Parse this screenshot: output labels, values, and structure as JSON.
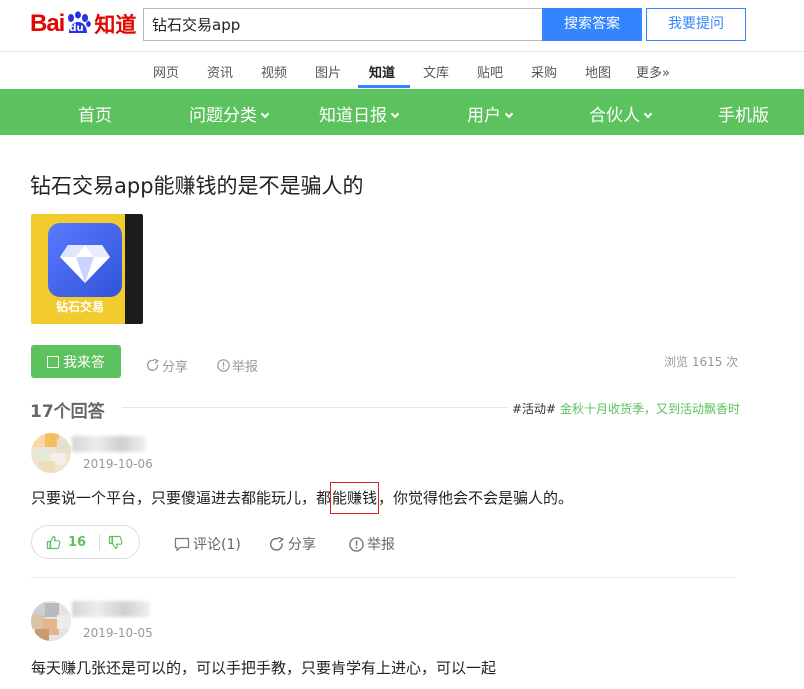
{
  "header": {
    "logo_bai": "Bai",
    "logo_du": "du",
    "logo_zhidao": "知道",
    "search_value": "钻石交易app",
    "search_button": "搜索答案",
    "ask_button": "我要提问"
  },
  "subnav": [
    "网页",
    "资讯",
    "视频",
    "图片",
    "知道",
    "文库",
    "贴吧",
    "采购",
    "地图",
    "更多»"
  ],
  "subnav_active": "知道",
  "greennav": {
    "home": "首页",
    "categories": "问题分类",
    "daily": "知道日报",
    "users": "用户",
    "partners": "合伙人",
    "mobile": "手机版"
  },
  "question": {
    "title": "钻石交易app能赚钱的是不是骗人的",
    "image_caption": "钻石交易",
    "answer_button": "我来答",
    "share": "分享",
    "report": "举报",
    "views": "浏览 1615 次"
  },
  "answers_header": {
    "count": "17个回答",
    "activity_tag": "#活动#",
    "activity_text": "金秋十月收货季，又到活动飘香时"
  },
  "answers": [
    {
      "date": "2019-10-06",
      "text_before": "只要说一个平台，只要傻逼进去都能玩儿，都",
      "text_highlight": "能赚钱",
      "text_after": "，你觉得他会不会是骗人的。",
      "likes": "16",
      "comments": "评论(1)",
      "share": "分享",
      "report": "举报"
    },
    {
      "date": "2019-10-05",
      "text": "每天赚几张还是可以的，可以手把手教，只要肯学有上进心，可以一起"
    }
  ],
  "colors": {
    "brand_red": "#e10601",
    "accent_blue": "#3385ff",
    "nav_green": "#5cc25d"
  }
}
